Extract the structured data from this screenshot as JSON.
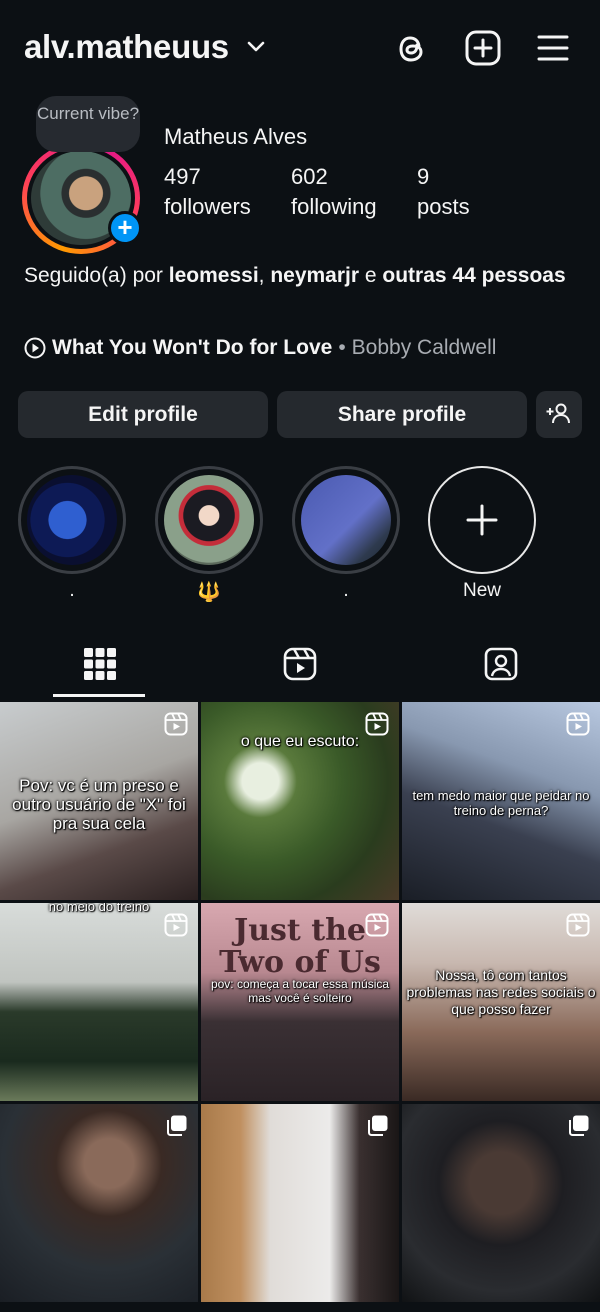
{
  "header": {
    "username": "alv.matheuus",
    "icons": [
      "threads-icon",
      "create-post-icon",
      "menu-icon"
    ]
  },
  "profile": {
    "note_bubble": "Current vibe?",
    "full_name": "Matheus Alves",
    "stats": [
      {
        "value": "497",
        "label": "followers"
      },
      {
        "value": "602",
        "label": "following"
      },
      {
        "value": "9",
        "label": "posts"
      }
    ],
    "followed_by": {
      "prefix": "Seguido(a) por ",
      "user1": "leomessi",
      "sep": ", ",
      "user2": "neymarjr",
      "conj": " e ",
      "rest": "outras 44 pessoas"
    },
    "music": {
      "song": "What You Won't Do for Love",
      "separator": "•",
      "artist": "Bobby Caldwell"
    }
  },
  "buttons": {
    "edit": "Edit profile",
    "share": "Share profile"
  },
  "highlights": [
    {
      "label": "."
    },
    {
      "label": "🔱"
    },
    {
      "label": "."
    },
    {
      "label": "New"
    }
  ],
  "grid": [
    {
      "caption": "Pov: vc é um preso e outro usuário de \"X\" foi pra sua cela",
      "type": "reel"
    },
    {
      "caption": "o que eu escuto:",
      "type": "reel"
    },
    {
      "caption": "tem medo maior que peidar no treino de perna?",
      "type": "reel"
    },
    {
      "caption": "no meio do treino",
      "type": "reel"
    },
    {
      "caption": "pov: começa a tocar essa música mas você é solteiro",
      "overlay_title": "Just the Two of Us",
      "type": "reel"
    },
    {
      "caption": "Nossa, tô com tantos problemas nas redes sociais o que posso fazer",
      "type": "reel"
    },
    {
      "caption": "",
      "type": "carousel"
    },
    {
      "caption": "",
      "type": "carousel"
    },
    {
      "caption": "",
      "type": "carousel"
    }
  ]
}
